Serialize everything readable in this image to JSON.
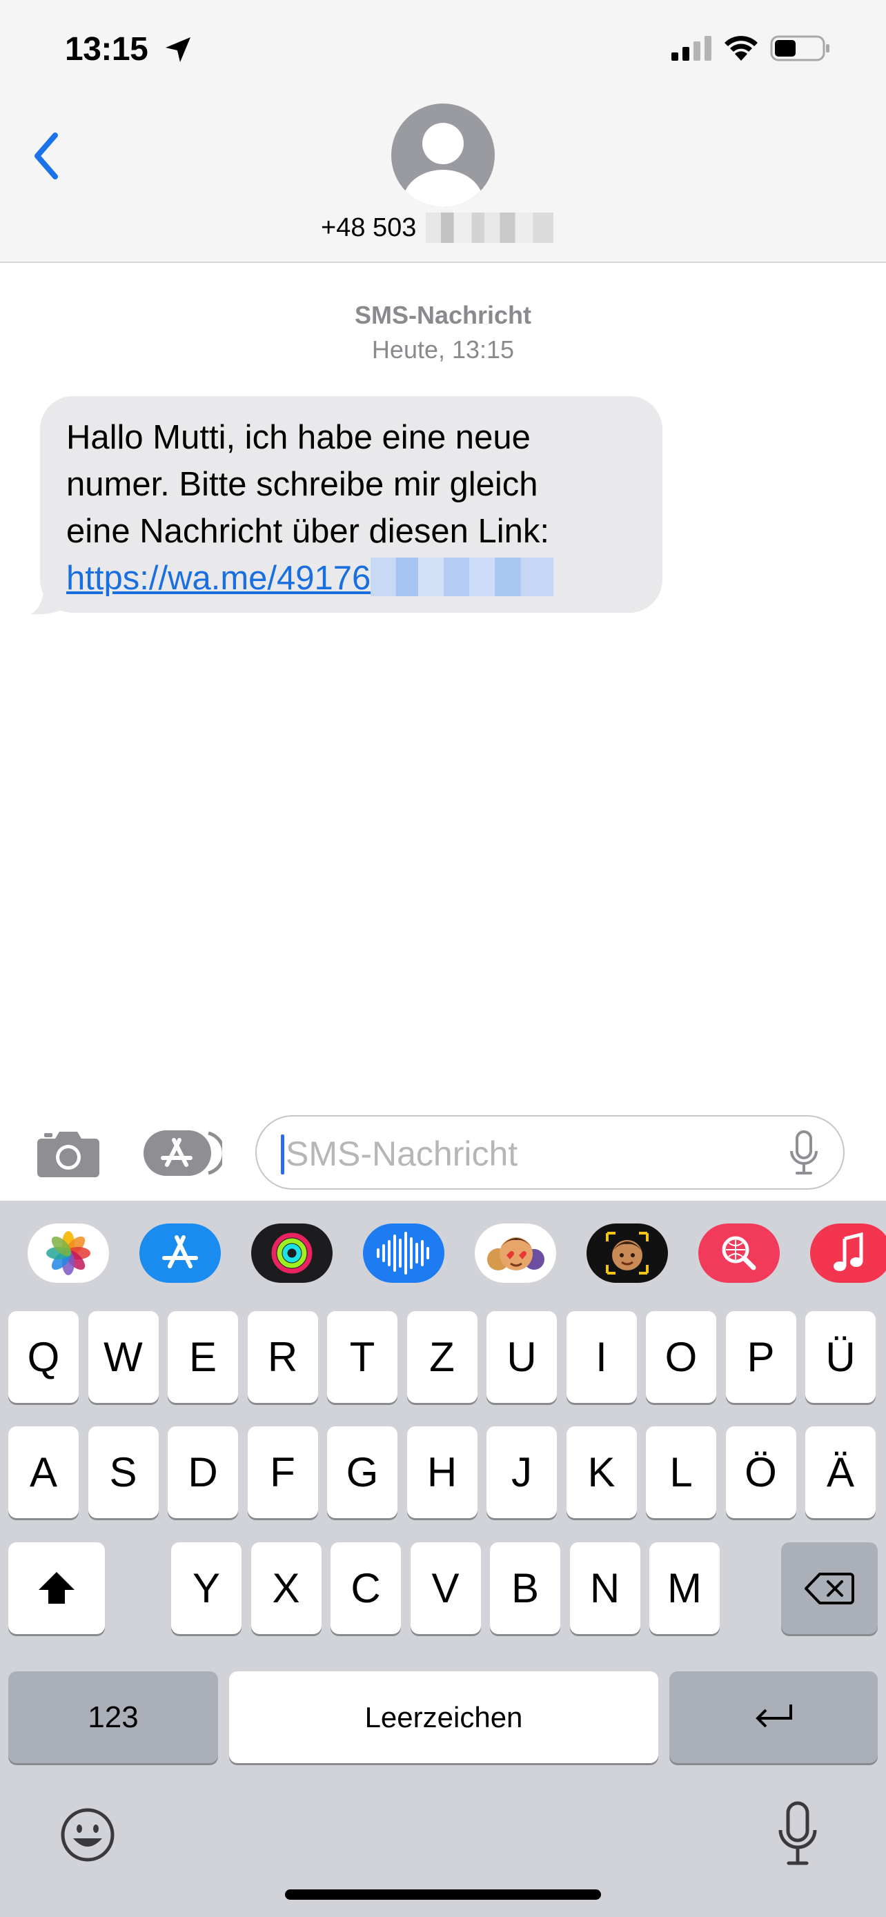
{
  "status_bar": {
    "time": "13:15",
    "location_icon": "location-arrow-icon",
    "signal_icon": "cellular-signal-icon",
    "wifi_icon": "wifi-icon",
    "battery_icon": "battery-icon",
    "battery_level": 0.45
  },
  "header": {
    "back_icon": "chevron-left-icon",
    "avatar_icon": "person-avatar-icon",
    "contact_number_visible": "+48 503"
  },
  "conversation": {
    "message_type": "SMS-Nachricht",
    "timestamp": "Heute, 13:15",
    "messages": [
      {
        "direction": "incoming",
        "lines": [
          "Hallo Mutti, ich habe eine neue",
          "numer. Bitte schreibe mir gleich",
          "eine Nachricht über diesen Link:"
        ],
        "link_visible": "https://wa.me/49176"
      }
    ]
  },
  "input_bar": {
    "placeholder": "SMS-Nachricht",
    "value": "",
    "camera_icon": "camera-icon",
    "apps_icon": "app-store-icon",
    "mic_icon": "microphone-icon"
  },
  "app_strip": [
    {
      "name": "Fotos",
      "icon": "photos-icon"
    },
    {
      "name": "App Store",
      "icon": "app-store-icon"
    },
    {
      "name": "Aktivität",
      "icon": "activity-rings-icon"
    },
    {
      "name": "Audio",
      "icon": "audio-waveform-icon"
    },
    {
      "name": "Memoji-Sticker",
      "icon": "memoji-stickers-icon"
    },
    {
      "name": "Memoji",
      "icon": "memoji-icon"
    },
    {
      "name": "Bildersuche",
      "icon": "image-search-icon"
    },
    {
      "name": "Musik",
      "icon": "music-icon"
    }
  ],
  "keyboard": {
    "row1": [
      "Q",
      "W",
      "E",
      "R",
      "T",
      "Z",
      "U",
      "I",
      "O",
      "P",
      "Ü"
    ],
    "row2": [
      "A",
      "S",
      "D",
      "F",
      "G",
      "H",
      "J",
      "K",
      "L",
      "Ö",
      "Ä"
    ],
    "row3": [
      "Y",
      "X",
      "C",
      "V",
      "B",
      "N",
      "M"
    ],
    "numbers_label": "123",
    "space_label": "Leerzeichen",
    "shift_icon": "shift-icon",
    "delete_icon": "delete-backspace-icon",
    "return_icon": "return-icon",
    "emoji_icon": "emoji-icon",
    "dictation_icon": "microphone-icon"
  }
}
